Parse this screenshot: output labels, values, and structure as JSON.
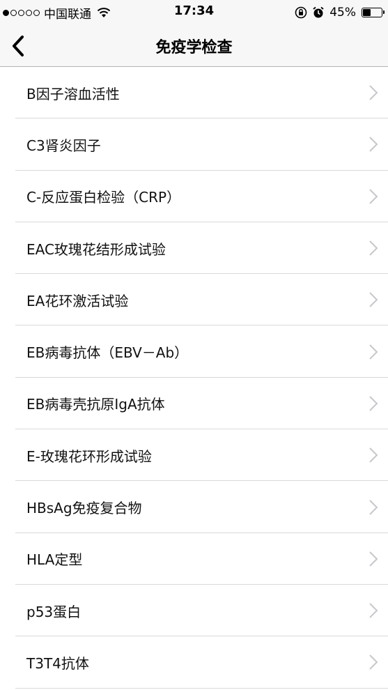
{
  "status_bar": {
    "carrier": "中国联通",
    "time": "17:34",
    "battery_percent": "45%",
    "battery_level": 0.45,
    "signal_dots": 5,
    "signal_filled": 1
  },
  "nav": {
    "title": "免疫学检查"
  },
  "items": [
    {
      "label": "B因子溶血活性"
    },
    {
      "label": "C3肾炎因子"
    },
    {
      "label": "C-反应蛋白检验（CRP）"
    },
    {
      "label": "EAC玫瑰花结形成试验"
    },
    {
      "label": "EA花环激活试验"
    },
    {
      "label": "EB病毒抗体（EBV－Ab）"
    },
    {
      "label": "EB病毒壳抗原IgA抗体"
    },
    {
      "label": "E-玫瑰花环形成试验"
    },
    {
      "label": "HBsAg免疫复合物"
    },
    {
      "label": "HLA定型"
    },
    {
      "label": "p53蛋白"
    },
    {
      "label": "T3T4抗体"
    }
  ]
}
